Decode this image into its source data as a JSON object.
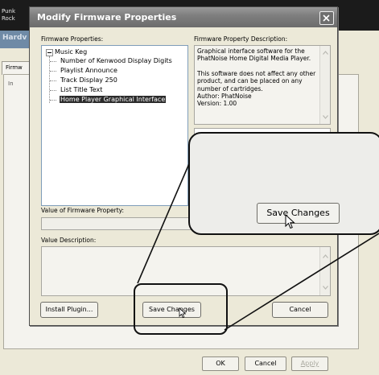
{
  "background": {
    "genres": [
      "Punk",
      "Rock"
    ],
    "title_fragment": "Hardv",
    "tab_fragment": "Firmw",
    "panel_fragment": "In",
    "buttons": {
      "ok": "OK",
      "cancel": "Cancel",
      "apply": "Apply"
    }
  },
  "dialog": {
    "title": "Modify Firmware Properties",
    "firmware_properties_label": "Firmware Properties:",
    "description_label": "Firmware Property Description:",
    "tree": {
      "root": "Music Keg",
      "children": [
        "Number of Kenwood Display Digits",
        "Playlist Announce",
        "Track Display 250",
        "List Title Text",
        "Home Player Graphical Interface"
      ],
      "selected_index": 4
    },
    "description_lines": [
      "Graphical interface software for the",
      "PhatNoise Home Digital Media Player.",
      "",
      "This software does not affect any other",
      "product, and can be placed on any",
      "number of cartridges.",
      "Author: PhatNoise",
      "Version: 1.00"
    ],
    "value_label": "Value of Firmware Property:",
    "value": "",
    "value_description_label": "Value Description:",
    "value_description": "",
    "buttons": {
      "install": "Install Plugin...",
      "save": "Save Changes",
      "cancel": "Cancel"
    }
  },
  "zoom": {
    "button_label": "Save Changes"
  },
  "colors": {
    "titlebar": "#7f7f7f",
    "selection": "#2b2b2b",
    "dialog_bg": "#ece9d8"
  }
}
